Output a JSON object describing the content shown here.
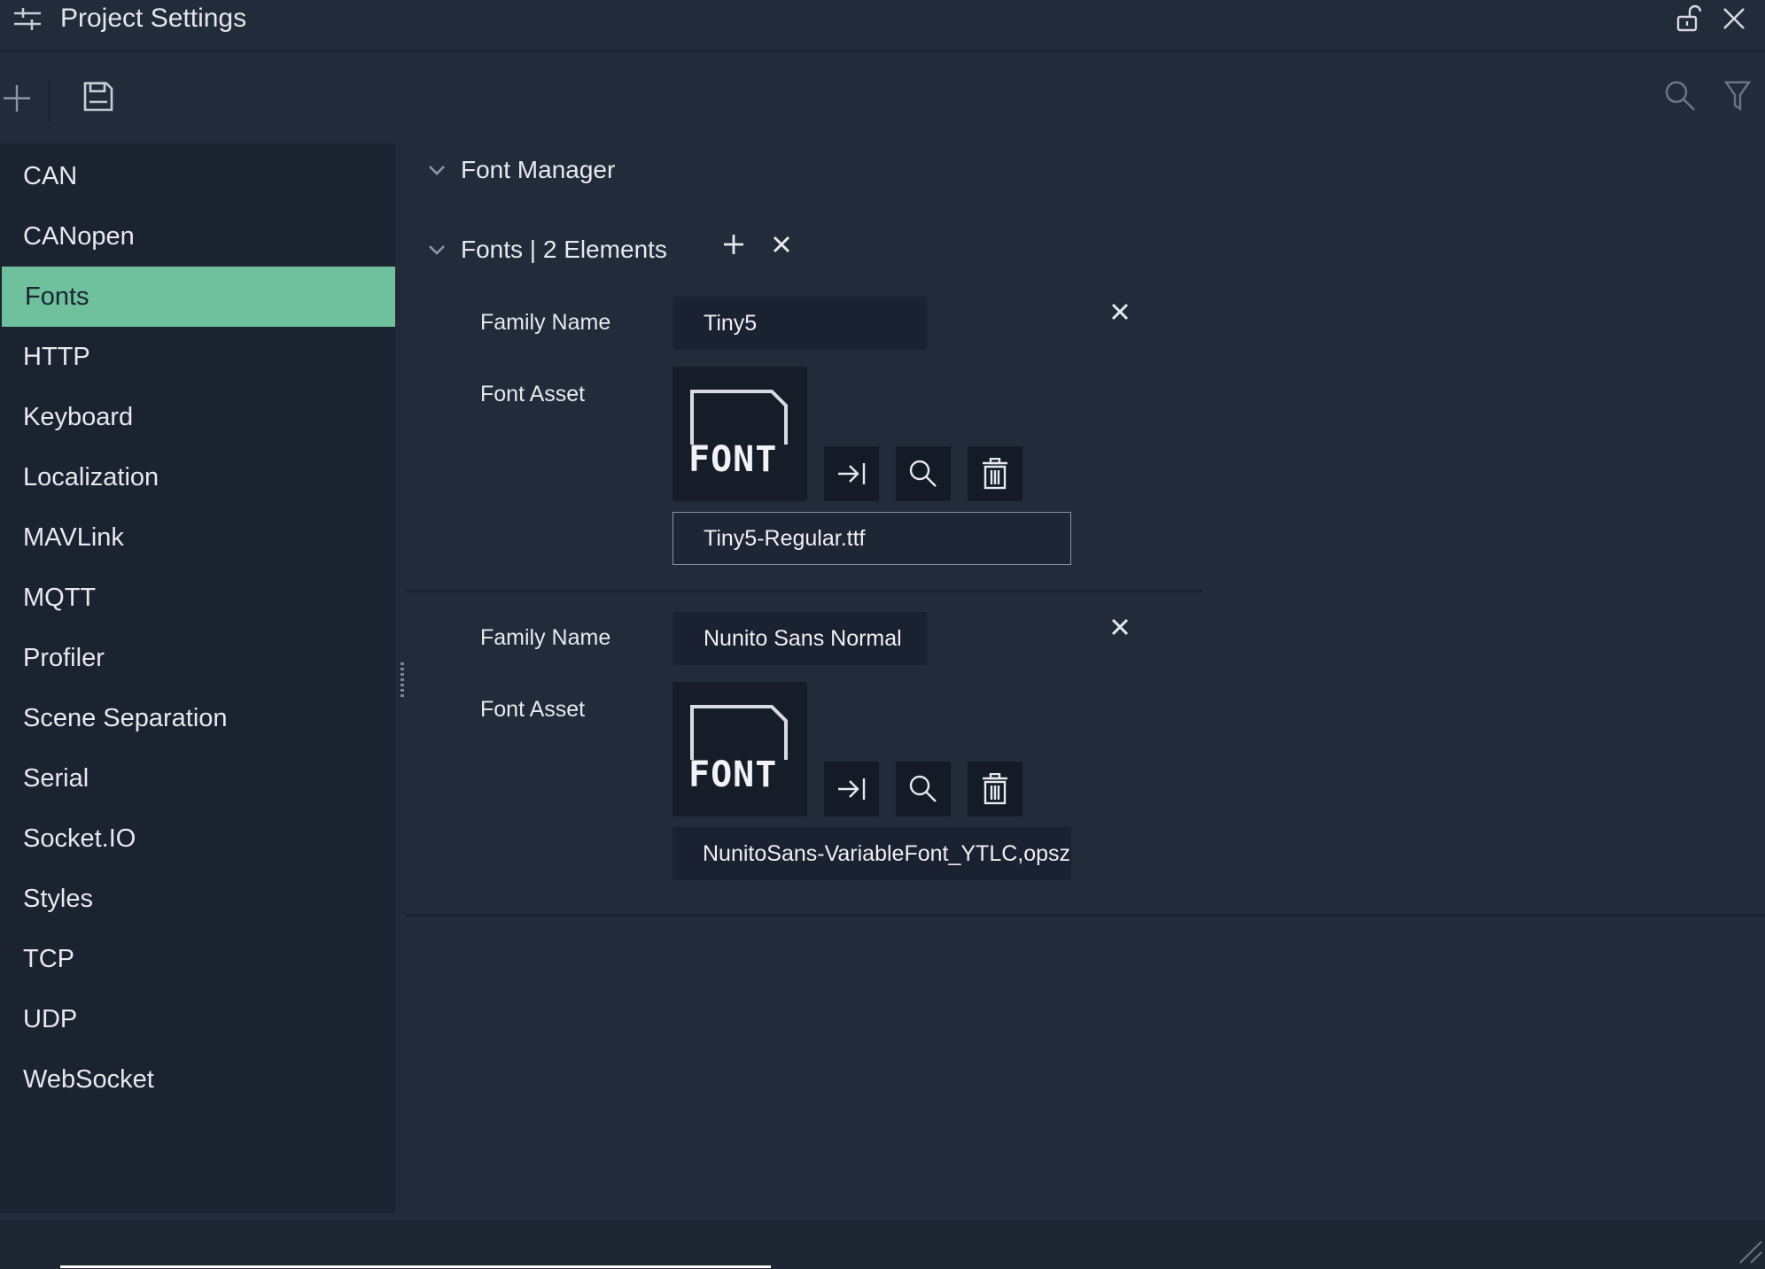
{
  "window": {
    "title": "Project Settings"
  },
  "sidebar": {
    "items": [
      {
        "label": "CAN"
      },
      {
        "label": "CANopen"
      },
      {
        "label": "Fonts"
      },
      {
        "label": "HTTP"
      },
      {
        "label": "Keyboard"
      },
      {
        "label": "Localization"
      },
      {
        "label": "MAVLink"
      },
      {
        "label": "MQTT"
      },
      {
        "label": "Profiler"
      },
      {
        "label": "Scene Separation"
      },
      {
        "label": "Serial"
      },
      {
        "label": "Socket.IO"
      },
      {
        "label": "Styles"
      },
      {
        "label": "TCP"
      },
      {
        "label": "UDP"
      },
      {
        "label": "WebSocket"
      }
    ],
    "active": "Fonts"
  },
  "main": {
    "section_title": "Font Manager",
    "list_title": "Fonts | 2 Elements",
    "fonts": [
      {
        "family_label": "Family Name",
        "family_value": "Tiny5",
        "asset_label": "Font Asset",
        "asset_thumb_text": "FONT",
        "asset_file": "Tiny5-Regular.ttf"
      },
      {
        "family_label": "Family Name",
        "family_value": "Nunito Sans Normal",
        "asset_label": "Font Asset",
        "asset_thumb_text": "FONT",
        "asset_file": "NunitoSans-VariableFont_YTLC,opsz,wdth,wght.ttf"
      }
    ]
  },
  "colors": {
    "background": "#222b3a",
    "sidebar": "#1b2230",
    "accent": "#6fc09c"
  },
  "icons": {
    "app": "settings-sliders-icon",
    "lock": "unlock-icon",
    "close": "close-icon",
    "add": "plus-icon",
    "save": "save-icon",
    "search": "search-icon",
    "filter": "filter-icon",
    "chevron": "chevron-down-icon",
    "assign": "assign-arrow-icon",
    "browse": "search-icon",
    "delete": "trash-icon"
  }
}
